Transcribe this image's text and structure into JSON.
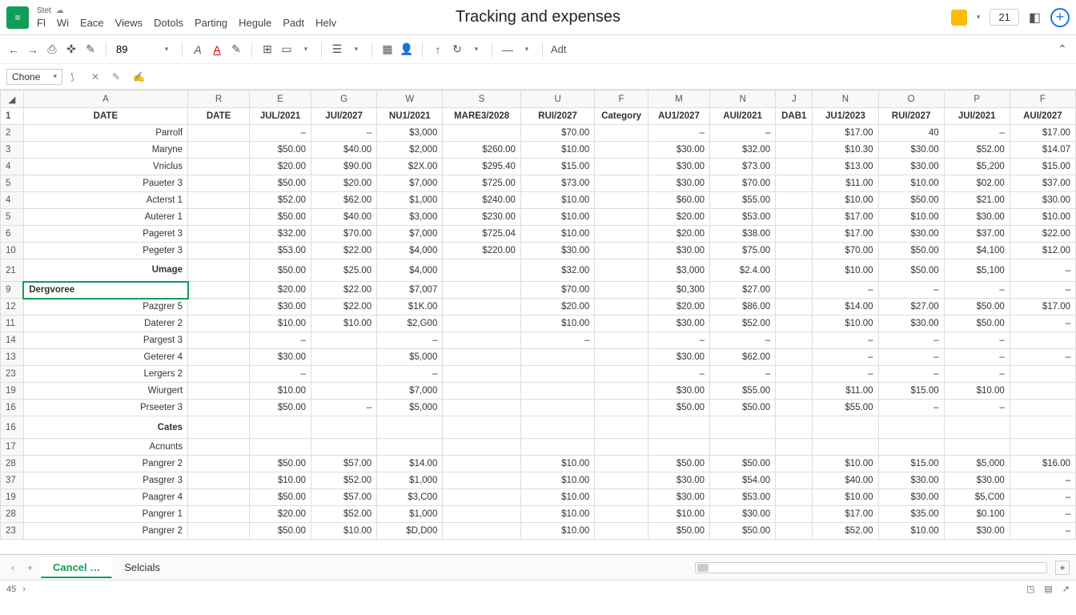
{
  "title": "Tracking and expenses",
  "small_label": "Stet",
  "menu": [
    "Fl",
    "Wi",
    "Eace",
    "Views",
    "Dotols",
    "Parting",
    "Hegule",
    "Padt",
    "Helv"
  ],
  "top_right": {
    "number": "21"
  },
  "toolbar": {
    "font_val": "89",
    "adt": "Adt",
    "strike": "—"
  },
  "name_box": "Chone",
  "status_left": "45",
  "sheet_tabs": [
    {
      "label": "Cancel …",
      "active": true
    },
    {
      "label": "Selcials",
      "active": false
    }
  ],
  "col_letters": [
    "A",
    "R",
    "E",
    "G",
    "W",
    "S",
    "U",
    "F",
    "M",
    "N",
    "J",
    "N",
    "O",
    "P",
    "F"
  ],
  "header_row": [
    "DATE",
    "DATE",
    "JUL/2021",
    "JUI/2027",
    "NU1/2021",
    "MARE3/2028",
    "RUI/2027",
    "Category",
    "AU1/2027",
    "AUI/2021",
    "DAB1",
    "JU1/2023",
    "RUI/2027",
    "JUI/2021",
    "AUI/2027"
  ],
  "rows": [
    {
      "n": "2",
      "c": [
        "Parrolf",
        "",
        "–",
        "–",
        "$3,000",
        "",
        "$70.00",
        "",
        "–",
        "–",
        "",
        "$17.00",
        "40",
        "–",
        "$17.00"
      ]
    },
    {
      "n": "3",
      "c": [
        "Maryne",
        "",
        "$50.00",
        "$40.00",
        "$2,000",
        "$260.00",
        "$10.00",
        "",
        "$30.00",
        "$32.00",
        "",
        "$10.30",
        "$30.00",
        "$52.00",
        "$14.07"
      ]
    },
    {
      "n": "4",
      "c": [
        "Vniclus",
        "",
        "$20.00",
        "$90.00",
        "$2X.00",
        "$295.40",
        "$15.00",
        "",
        "$30.00",
        "$73.00",
        "",
        "$13.00",
        "$30.00",
        "$5,200",
        "$15.00"
      ]
    },
    {
      "n": "5",
      "c": [
        "Paueter 3",
        "",
        "$50.00",
        "$20.00",
        "$7,000",
        "$725.00",
        "$73.00",
        "",
        "$30.00",
        "$70.00",
        "",
        "$11.00",
        "$10.00",
        "$02.00",
        "$37.00"
      ]
    },
    {
      "n": "4",
      "c": [
        "Acterst 1",
        "",
        "$52.00",
        "$62.00",
        "$1,000",
        "$240.00",
        "$10.00",
        "",
        "$60.00",
        "$55.00",
        "",
        "$10.00",
        "$50.00",
        "$21.00",
        "$30.00"
      ]
    },
    {
      "n": "5",
      "c": [
        "Auterer 1",
        "",
        "$50.00",
        "$40.00",
        "$3,000",
        "$230.00",
        "$10.00",
        "",
        "$20.00",
        "$53.00",
        "",
        "$17.00",
        "$10.00",
        "$30.00",
        "$10.00"
      ]
    },
    {
      "n": "6",
      "c": [
        "Pageret 3",
        "",
        "$32.00",
        "$70.00",
        "$7,000",
        "$725.04",
        "$10.00",
        "",
        "$20.00",
        "$38.00",
        "",
        "$17.00",
        "$30.00",
        "$37.00",
        "$22.00"
      ]
    },
    {
      "n": "10",
      "c": [
        "Pegeter 3",
        "",
        "$53.00",
        "$22.00",
        "$4,000",
        "$220.00",
        "$30.00",
        "",
        "$30.00",
        "$75.00",
        "",
        "$70.00",
        "$50.00",
        "$4,100",
        "$12.00"
      ]
    },
    {
      "n": "21",
      "c": [
        "Umage",
        "",
        "$50.00",
        "$25.00",
        "$4,000",
        "",
        "$32.00",
        "",
        "$3,000",
        "$2.4.00",
        "",
        "$10.00",
        "$50.00",
        "$5,100",
        "–"
      ],
      "bold": true,
      "tall": true
    },
    {
      "n": "9",
      "c": [
        "Dergvoree",
        "",
        "$20.00",
        "$22.00",
        "$7,007",
        "",
        "$70.00",
        "",
        "$0,300",
        "$27.00",
        "",
        "–",
        "–",
        "–",
        "–"
      ],
      "selected": true
    },
    {
      "n": "12",
      "c": [
        "Pazgrer 5",
        "",
        "$30.00",
        "$22.00",
        "$1K.00",
        "",
        "$20.00",
        "",
        "$20.00",
        "$86.00",
        "",
        "$14.00",
        "$27.00",
        "$50.00",
        "$17.00"
      ]
    },
    {
      "n": "11",
      "c": [
        "Daterer 2",
        "",
        "$10.00",
        "$10.00",
        "$2,G00",
        "",
        "$10.00",
        "",
        "$30.00",
        "$52.00",
        "",
        "$10.00",
        "$30.00",
        "$50.00",
        "–"
      ]
    },
    {
      "n": "14",
      "c": [
        "Pargest 3",
        "",
        "–",
        "",
        "–",
        "",
        "–",
        "",
        "–",
        "–",
        "",
        "–",
        "–",
        "–",
        ""
      ]
    },
    {
      "n": "13",
      "c": [
        "Geterer 4",
        "",
        "$30.00",
        "",
        "$5,000",
        "",
        "",
        "",
        "$30.00",
        "$62.00",
        "",
        "–",
        "–",
        "–",
        "–"
      ]
    },
    {
      "n": "23",
      "c": [
        "Lergers 2",
        "",
        "–",
        "",
        "–",
        "",
        "",
        "",
        "–",
        "–",
        "",
        "–",
        "–",
        "–",
        ""
      ]
    },
    {
      "n": "19",
      "c": [
        "Wiurgert",
        "",
        "$10.00",
        "",
        "$7,000",
        "",
        "",
        "",
        "$30.00",
        "$55.00",
        "",
        "$11.00",
        "$15.00",
        "$10.00",
        ""
      ]
    },
    {
      "n": "16",
      "c": [
        "Prseeter 3",
        "",
        "$50.00",
        "–",
        "$5,000",
        "",
        "",
        "",
        "$50.00",
        "$50.00",
        "",
        "$55.00",
        "–",
        "–",
        ""
      ]
    },
    {
      "n": "16",
      "c": [
        "Cates",
        "",
        "",
        "",
        "",
        "",
        "",
        "",
        "",
        "",
        "",
        "",
        "",
        "",
        ""
      ],
      "bold": true,
      "tall": true
    },
    {
      "n": "17",
      "c": [
        "Acnunts",
        "",
        "",
        "",
        "",
        "",
        "",
        "",
        "",
        "",
        "",
        "",
        "",
        "",
        ""
      ]
    },
    {
      "n": "28",
      "c": [
        "Pangrer 2",
        "",
        "$50.00",
        "$57.00",
        "$14.00",
        "",
        "$10.00",
        "",
        "$50.00",
        "$50.00",
        "",
        "$10.00",
        "$15.00",
        "$5,000",
        "$16.00"
      ]
    },
    {
      "n": "37",
      "c": [
        "Pasgrer 3",
        "",
        "$10.00",
        "$52.00",
        "$1,000",
        "",
        "$10.00",
        "",
        "$30.00",
        "$54.00",
        "",
        "$40.00",
        "$30.00",
        "$30.00",
        "–"
      ]
    },
    {
      "n": "19",
      "c": [
        "Paagrer 4",
        "",
        "$50.00",
        "$57.00",
        "$3,C00",
        "",
        "$10.00",
        "",
        "$30.00",
        "$53.00",
        "",
        "$10.00",
        "$30.00",
        "$5,C00",
        "–"
      ]
    },
    {
      "n": "28",
      "c": [
        "Pangrer 1",
        "",
        "$20.00",
        "$52.00",
        "$1,000",
        "",
        "$10.00",
        "",
        "$10.00",
        "$30.00",
        "",
        "$17.00",
        "$35.00",
        "$0.100",
        "–"
      ]
    },
    {
      "n": "23",
      "c": [
        "Pangrer 2",
        "",
        "$50.00",
        "$10.00",
        "$D,D00",
        "",
        "$10.00",
        "",
        "$50.00",
        "$50.00",
        "",
        "$52.00",
        "$10.00",
        "$30.00",
        "–"
      ]
    }
  ]
}
